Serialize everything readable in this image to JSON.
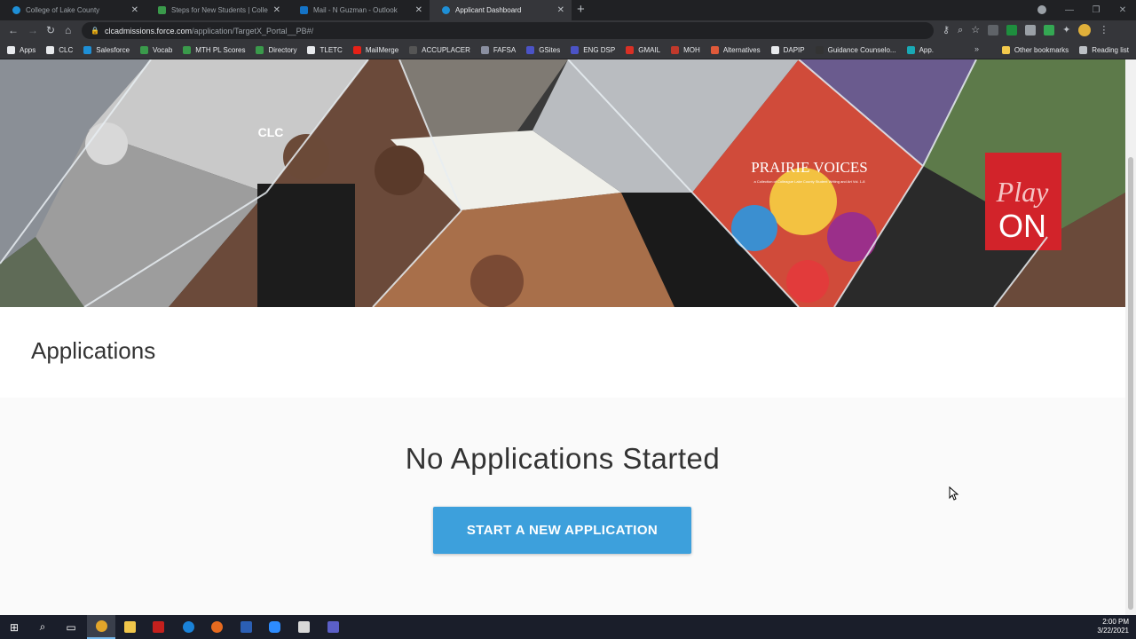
{
  "browser": {
    "tabs": [
      {
        "label": "College of Lake County",
        "active": false,
        "favicon": "cloud-icon",
        "color": "#1e8fd6"
      },
      {
        "label": "Steps for New Students | College",
        "active": false,
        "favicon": "leaf-icon",
        "color": "#3a9a4b"
      },
      {
        "label": "Mail - N Guzman - Outlook",
        "active": false,
        "favicon": "outlook-icon",
        "color": "#1473c6"
      },
      {
        "label": "Applicant Dashboard",
        "active": true,
        "favicon": "cloud-icon",
        "color": "#1e8fd6"
      }
    ],
    "new_tab": "+",
    "url_host": "clcadmissions.force.com",
    "url_path": "/application/TargetX_Portal__PB#/",
    "bookmarks": [
      {
        "label": "Apps",
        "icon": "apps-grid-icon",
        "color": "#e8eaed"
      },
      {
        "label": "CLC",
        "icon": "globe-icon",
        "color": "#e8eaed"
      },
      {
        "label": "Salesforce",
        "icon": "cloud-icon",
        "color": "#1e8fd6"
      },
      {
        "label": "Vocab",
        "icon": "leaf-icon",
        "color": "#3a9a4b"
      },
      {
        "label": "MTH PL Scores",
        "icon": "leaf-icon",
        "color": "#3a9a4b"
      },
      {
        "label": "Directory",
        "icon": "leaf-icon",
        "color": "#3a9a4b"
      },
      {
        "label": "TLETC",
        "icon": "globe-icon",
        "color": "#e8eaed"
      },
      {
        "label": "MailMerge",
        "icon": "youtube-icon",
        "color": "#e62117"
      },
      {
        "label": "ACCUPLACER",
        "icon": "dots-icon",
        "color": "#555555"
      },
      {
        "label": "FAFSA",
        "icon": "fafsa-icon",
        "color": "#8a8fa0"
      },
      {
        "label": "GSites",
        "icon": "gsites-icon",
        "color": "#4b53c6"
      },
      {
        "label": "ENG DSP",
        "icon": "grid-icon",
        "color": "#4b53c6"
      },
      {
        "label": "GMAIL",
        "icon": "gmail-icon",
        "color": "#d93025"
      },
      {
        "label": "MOH",
        "icon": "moh-icon",
        "color": "#c0392b"
      },
      {
        "label": "Alternatives",
        "icon": "alternatives-icon",
        "color": "#e05a3a"
      },
      {
        "label": "DAPIP",
        "icon": "document-icon",
        "color": "#e8eaed"
      },
      {
        "label": "Guidance Counselo...",
        "icon": "bb-icon",
        "color": "#333333"
      },
      {
        "label": "App.",
        "icon": "app-icon",
        "color": "#19a9b5"
      }
    ],
    "bookmarks_more": "»",
    "other_bookmarks": "Other bookmarks",
    "reading_list": "Reading list"
  },
  "banner": {
    "text_prairie": "PRAIRIE VOICES",
    "text_prairie_sub": "a Collection of Colleague Lake County Student Writing and Art Vol. 1-8",
    "text_play": "Play",
    "text_on": "ON",
    "text_clc": "CLC"
  },
  "main": {
    "section_title": "Applications",
    "empty_message": "No Applications Started",
    "start_button": "START A NEW APPLICATION"
  },
  "taskbar": {
    "time": "2:00 PM",
    "date": "3/22/2021"
  }
}
